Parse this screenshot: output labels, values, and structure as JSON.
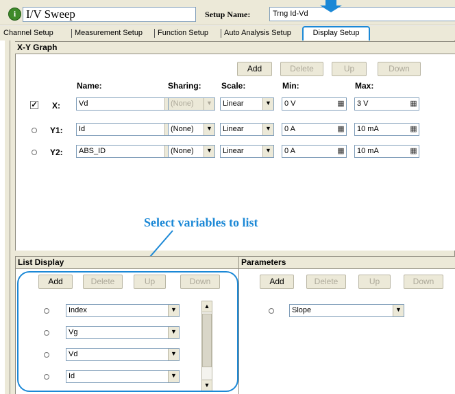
{
  "window": {
    "title": "I/V Sweep",
    "setup_name_label": "Setup Name:",
    "setup_name_value": "Trng Id-Vd"
  },
  "tabs": [
    {
      "label": "Channel Setup"
    },
    {
      "label": "Measurement Setup"
    },
    {
      "label": "Function Setup"
    },
    {
      "label": "Auto Analysis Setup"
    },
    {
      "label": "Display Setup",
      "active": true
    }
  ],
  "xy_graph": {
    "header": "X-Y Graph",
    "buttons": {
      "add": "Add",
      "delete": "Delete",
      "up": "Up",
      "down": "Down"
    },
    "columns": {
      "name": "Name:",
      "sharing": "Sharing:",
      "scale": "Scale:",
      "min": "Min:",
      "max": "Max:"
    },
    "rows": [
      {
        "label": "X:",
        "selector": "checkbox",
        "checked": true,
        "name": "Vd",
        "sharing": "(None)",
        "sharing_disabled": true,
        "scale": "Linear",
        "min": "0 V",
        "max": "3 V"
      },
      {
        "label": "Y1:",
        "selector": "radio",
        "checked": false,
        "name": "Id",
        "sharing": "(None)",
        "sharing_disabled": false,
        "scale": "Linear",
        "min": "0 A",
        "max": "10 mA"
      },
      {
        "label": "Y2:",
        "selector": "radio",
        "checked": false,
        "name": "ABS_ID",
        "sharing": "(None)",
        "sharing_disabled": false,
        "scale": "Linear",
        "min": "0 A",
        "max": "10 mA"
      }
    ]
  },
  "annotation": {
    "text": "Select variables to list",
    "color": "#1b88d6"
  },
  "list_display": {
    "header": "List Display",
    "buttons": {
      "add": "Add",
      "delete": "Delete",
      "up": "Up",
      "down": "Down"
    },
    "items": [
      "Index",
      "Vg",
      "Vd",
      "Id"
    ]
  },
  "parameters": {
    "header": "Parameters",
    "buttons": {
      "add": "Add",
      "delete": "Delete",
      "up": "Up",
      "down": "Down"
    },
    "items": [
      "Slope"
    ]
  },
  "colors": {
    "accent": "#1b88d6",
    "panel": "#ece9d8",
    "field_border": "#7f9db9",
    "disabled_text": "#aca899"
  }
}
